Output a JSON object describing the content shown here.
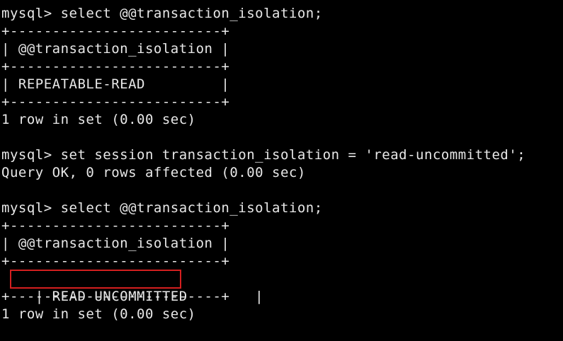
{
  "terminal": {
    "lines": [
      "mysql> select @@transaction_isolation;",
      "+-------------------------+",
      "| @@transaction_isolation |",
      "+-------------------------+",
      "| REPEATABLE-READ         |",
      "+-------------------------+",
      "1 row in set (0.00 sec)",
      "",
      "mysql> set session transaction_isolation = 'read-uncommitted';",
      "Query OK, 0 rows affected (0.00 sec)",
      "",
      "mysql> select @@transaction_isolation;",
      "+-------------------------+",
      "| @@transaction_isolation |",
      "+-------------------------+",
      "| READ-UNCOMMITTED        |",
      "+-------------------------+",
      "1 row in set (0.00 sec)"
    ],
    "highlight_color": "#d41f1f",
    "text_color": "#e8e8e8",
    "background_color": "#000000"
  }
}
